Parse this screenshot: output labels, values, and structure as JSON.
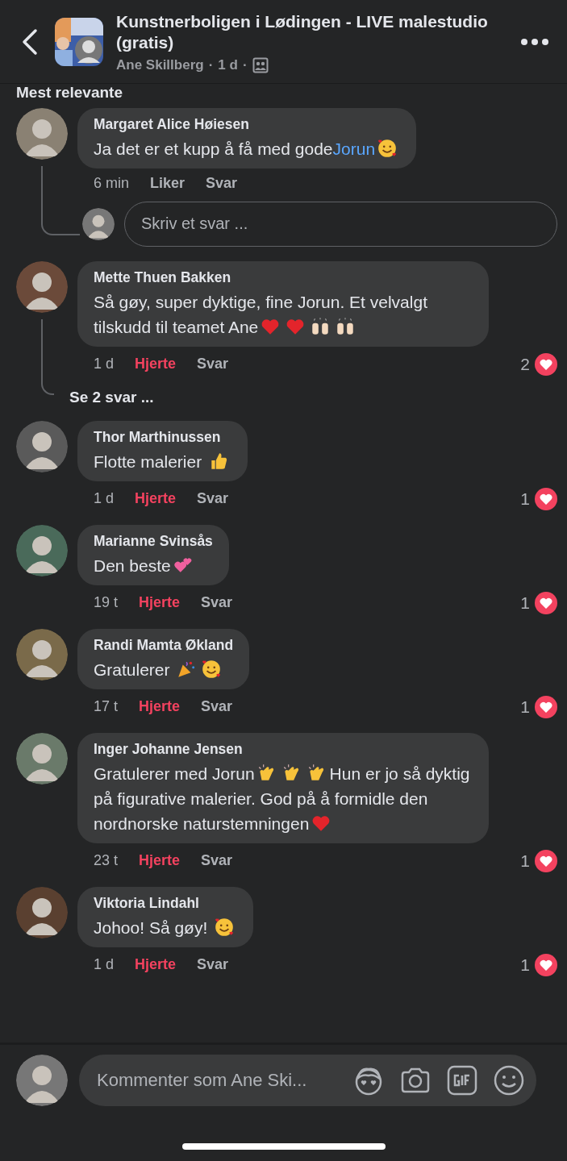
{
  "header": {
    "title": "Kunstnerboligen i Lødingen - LIVE malestudio (gratis)",
    "author": "Ane Skillberg",
    "age": "1 d",
    "separators": [
      "·",
      "·"
    ]
  },
  "sort_label": "Mest relevante",
  "comments": [
    {
      "name": "Margaret Alice Høiesen",
      "parts": [
        {
          "kind": "text",
          "text": "Ja det er et kupp å få med gode"
        },
        {
          "kind": "mention",
          "text": "Jorun"
        },
        {
          "kind": "hugface"
        }
      ],
      "time": "6 min",
      "react_label": "Liker",
      "reacted": false,
      "reply_label": "Svar",
      "reply_placeholder": "Skriv et svar ..."
    },
    {
      "name": "Mette Thuen Bakken",
      "parts": [
        {
          "kind": "text",
          "text": "Så gøy, super dyktige, fine Jorun. Et velvalgt tilskudd til teamet Ane"
        },
        {
          "kind": "heart"
        },
        {
          "kind": "heart"
        },
        {
          "kind": "hands"
        },
        {
          "kind": "hands"
        }
      ],
      "time": "1 d",
      "react_label": "Hjerte",
      "reacted": true,
      "reply_label": "Svar",
      "count": "2",
      "replies_link": "Se 2 svar ..."
    },
    {
      "name": "Thor Marthinussen",
      "parts": [
        {
          "kind": "text",
          "text": "Flotte malerier "
        },
        {
          "kind": "thumb"
        }
      ],
      "time": "1 d",
      "react_label": "Hjerte",
      "reacted": true,
      "reply_label": "Svar",
      "count": "1"
    },
    {
      "name": "Marianne Svinsås",
      "parts": [
        {
          "kind": "text",
          "text": "Den beste"
        },
        {
          "kind": "hearts"
        }
      ],
      "time": "19 t",
      "react_label": "Hjerte",
      "reacted": true,
      "reply_label": "Svar",
      "count": "1"
    },
    {
      "name": "Randi Mamta Økland",
      "parts": [
        {
          "kind": "text",
          "text": "Gratulerer "
        },
        {
          "kind": "party"
        },
        {
          "kind": "hugface"
        }
      ],
      "time": "17 t",
      "react_label": "Hjerte",
      "reacted": true,
      "reply_label": "Svar",
      "count": "1"
    },
    {
      "name": "Inger Johanne Jensen",
      "parts": [
        {
          "kind": "text",
          "text": "Gratulerer med Jorun"
        },
        {
          "kind": "clap"
        },
        {
          "kind": "clap"
        },
        {
          "kind": "clap"
        },
        {
          "kind": "text",
          "text": "Hun er jo så dyktig på figurative malerier. God på å formidle den nordnorske naturstemningen"
        },
        {
          "kind": "heart"
        }
      ],
      "time": "23 t",
      "react_label": "Hjerte",
      "reacted": true,
      "reply_label": "Svar",
      "count": "1"
    },
    {
      "name": "Viktoria Lindahl",
      "parts": [
        {
          "kind": "text",
          "text": "Johoo! Så gøy! "
        },
        {
          "kind": "hugface"
        }
      ],
      "time": "1 d",
      "react_label": "Hjerte",
      "reacted": true,
      "reply_label": "Svar",
      "count": "1"
    }
  ],
  "composer": {
    "placeholder": "Kommenter som Ane Ski..."
  }
}
